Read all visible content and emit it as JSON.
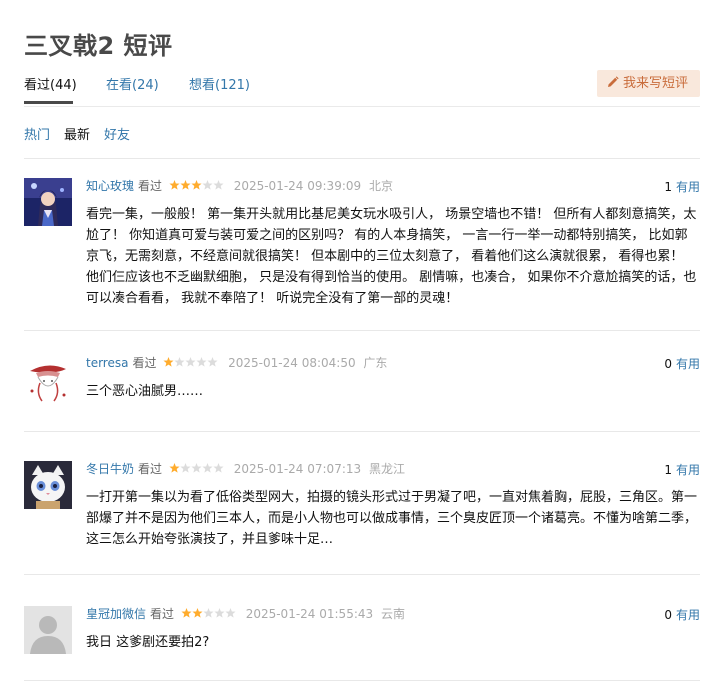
{
  "page": {
    "title": "三叉戟2 短评"
  },
  "tabs": [
    {
      "label": "看过(44)"
    },
    {
      "label": "在看(24)"
    },
    {
      "label": "想看(121)"
    }
  ],
  "write_button": {
    "label": "我来写短评"
  },
  "sort": [
    {
      "label": "热门"
    },
    {
      "label": "最新"
    },
    {
      "label": "好友"
    }
  ],
  "colors": {
    "link": "#3377aa",
    "star": "#ffac2d",
    "button_bg": "#f9e8dc",
    "button_text": "#c96c3b"
  },
  "comments": [
    {
      "user": "知心玫瑰",
      "action": "看过",
      "stars": 3,
      "time": "2025-01-24 09:39:09",
      "location": "北京",
      "votes": "1",
      "helpful": "有用",
      "text": "看完一集，一般般！ 第一集开头就用比基尼美女玩水吸引人， 场景空墙也不错！ 但所有人都刻意搞笑，太尬了！ 你知道真可爱与装可爱之间的区别吗？ 有的人本身搞笑， 一言一行一举一动都特别搞笑， 比如郭京飞，无需刻意，不经意间就很搞笑！ 但本剧中的三位太刻意了， 看着他们这么演就很累， 看得也累！ 他们仨应该也不乏幽默细胞， 只是没有得到恰当的使用。 剧情嘛，也凑合， 如果你不介意尬搞笑的话，也可以凑合看看， 我就不奉陪了！ 听说完全没有了第一部的灵魂！"
    },
    {
      "user": "terresa",
      "action": "看过",
      "stars": 1,
      "time": "2025-01-24 08:04:50",
      "location": "广东",
      "votes": "0",
      "helpful": "有用",
      "text": "三个恶心油腻男……"
    },
    {
      "user": "冬日牛奶",
      "action": "看过",
      "stars": 1,
      "time": "2025-01-24 07:07:13",
      "location": "黑龙江",
      "votes": "1",
      "helpful": "有用",
      "text": "一打开第一集以为看了低俗类型网大，拍摄的镜头形式过于男凝了吧，一直对焦着胸，屁股，三角区。第一部爆了并不是因为他们三本人，而是小人物也可以做成事情，三个臭皮匠顶一个诸葛亮。不懂为啥第二季，这三怎么开始夸张演技了，并且爹味十足…"
    },
    {
      "user": "皇冠加微信",
      "action": "看过",
      "stars": 2,
      "time": "2025-01-24 01:55:43",
      "location": "云南",
      "votes": "0",
      "helpful": "有用",
      "text": "我日 这爹剧还要拍2?"
    }
  ]
}
